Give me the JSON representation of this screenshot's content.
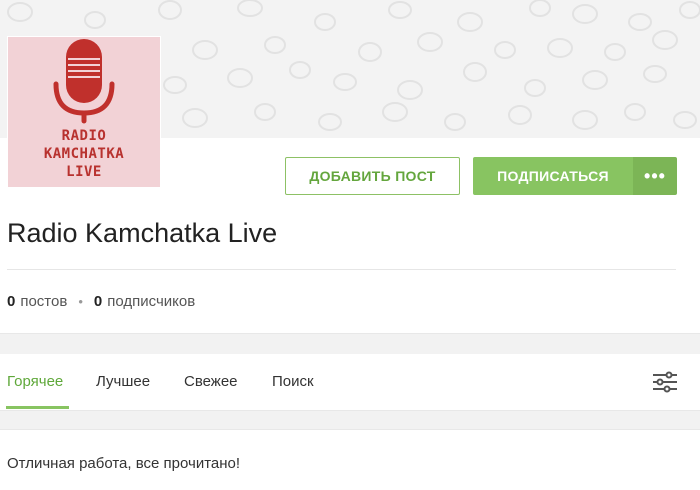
{
  "community": {
    "name": "Radio Kamchatka Live",
    "avatar_lines": [
      "RADIO",
      "KAMCHATKA",
      "LIVE"
    ]
  },
  "actions": {
    "add_post_label": "ДОБАВИТЬ ПОСТ",
    "subscribe_label": "ПОДПИСАТЬСЯ",
    "more_label": "•••"
  },
  "stats": {
    "posts_count": "0",
    "posts_label": "постов",
    "subscribers_count": "0",
    "subscribers_label": "подписчиков",
    "separator": "•"
  },
  "tabs": [
    {
      "label": "Горячее",
      "active": true
    },
    {
      "label": "Лучшее",
      "active": false
    },
    {
      "label": "Свежее",
      "active": false
    },
    {
      "label": "Поиск",
      "active": false
    }
  ],
  "feed": {
    "empty_message": "Отличная работа, все прочитано!"
  },
  "colors": {
    "accent": "#88c461",
    "accent_dark": "#5fa83a",
    "avatar_bg": "#f2d2d6",
    "avatar_fg": "#b8322f"
  },
  "icons": {
    "more": "more-dots-icon",
    "settings": "filter-sliders-icon",
    "avatar": "microphone-icon"
  }
}
